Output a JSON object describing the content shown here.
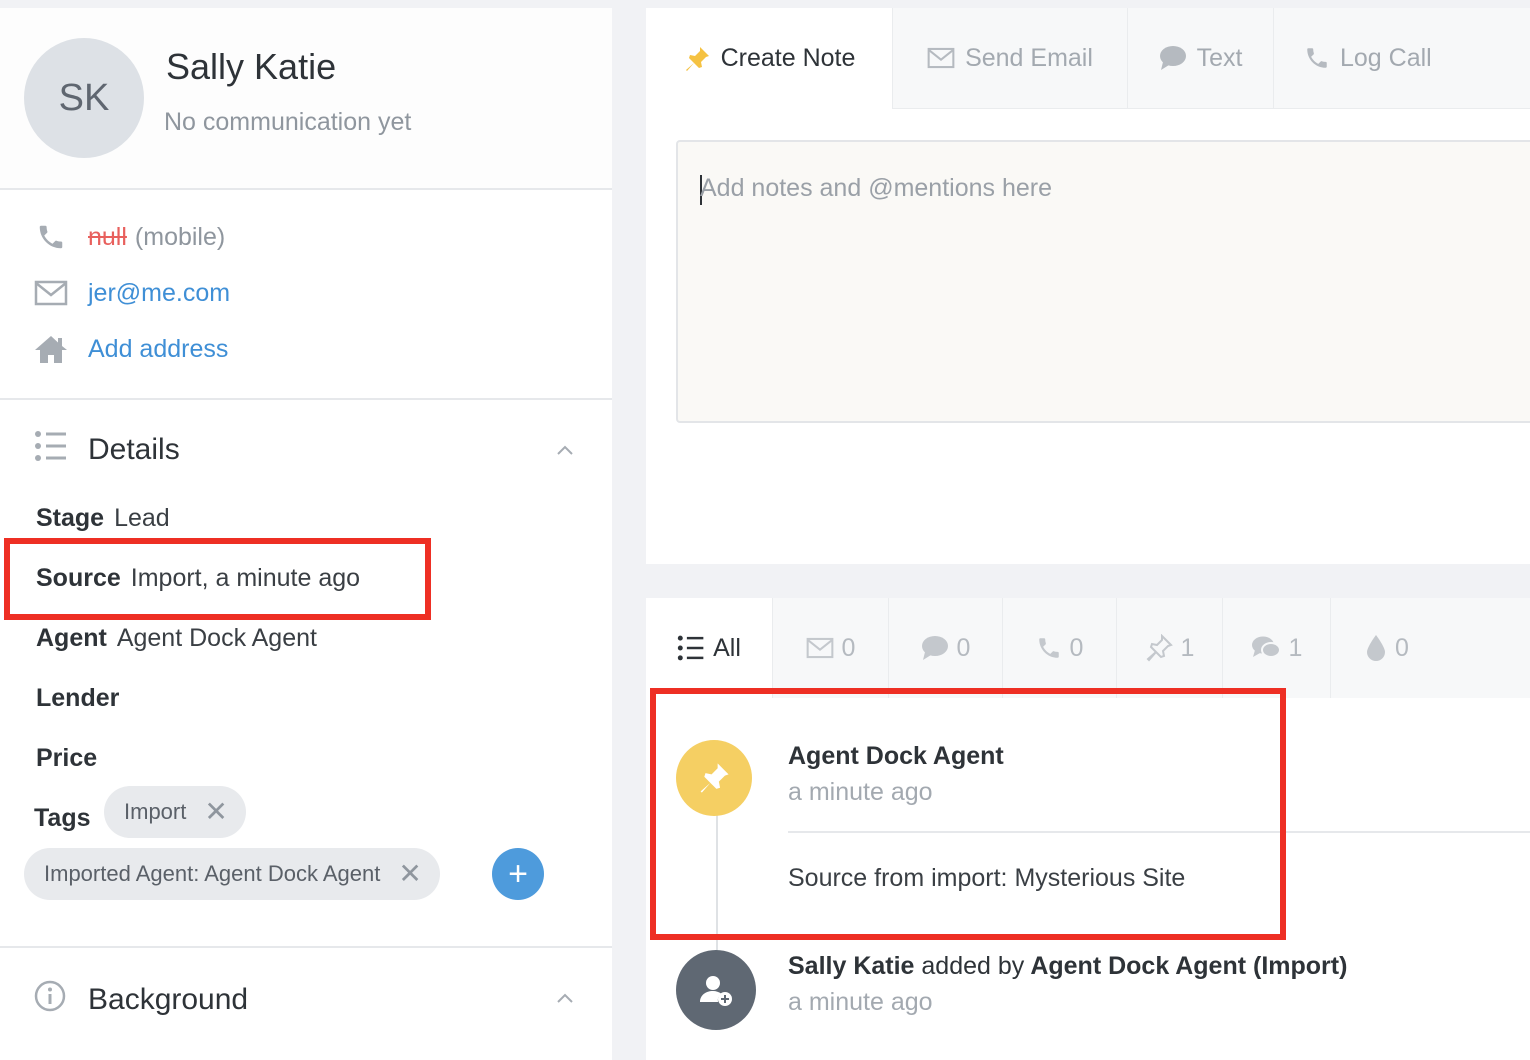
{
  "profile": {
    "initials": "SK",
    "name": "Sally Katie",
    "status": "No communication yet"
  },
  "contact": {
    "phone_value": "null",
    "phone_type": "(mobile)",
    "email": "jer@me.com",
    "address_link": "Add address"
  },
  "details": {
    "heading": "Details",
    "stage_label": "Stage",
    "stage_value": "Lead",
    "source_label": "Source",
    "source_value": "Import, a minute ago",
    "agent_label": "Agent",
    "agent_value": "Agent Dock Agent",
    "lender_label": "Lender",
    "price_label": "Price",
    "tags_label": "Tags",
    "tags": [
      "Import",
      "Imported Agent: Agent Dock Agent"
    ],
    "remove_symbol": "✕",
    "add_symbol": "+"
  },
  "background": {
    "heading": "Background"
  },
  "composer": {
    "tabs": [
      "Create Note",
      "Send Email",
      "Text",
      "Log Call"
    ],
    "note_placeholder": "Add notes and @mentions here"
  },
  "feed": {
    "filters": {
      "all": "All",
      "email_count": "0",
      "text_count": "0",
      "call_count": "0",
      "note_count": "1",
      "chat_count": "1",
      "drip_count": "0"
    },
    "events": [
      {
        "author": "Agent Dock Agent",
        "time": "a minute ago",
        "body": "Source from import: Mysterious Site"
      },
      {
        "person": "Sally Katie",
        "action": "added by",
        "actor": "Agent Dock Agent (Import)",
        "time": "a minute ago"
      }
    ]
  },
  "colors": {
    "accent": "#3f8fd6",
    "highlight_box": "#ee2f24",
    "note_icon": "#f5cf63",
    "person_icon": "#5f6873"
  },
  "icons": [
    "phone-icon",
    "envelope-icon",
    "home-icon",
    "list-icon",
    "chevron-up-icon",
    "info-icon",
    "pin-icon",
    "chat-bubble-icon",
    "chats-icon",
    "drop-icon",
    "add-person-icon"
  ]
}
